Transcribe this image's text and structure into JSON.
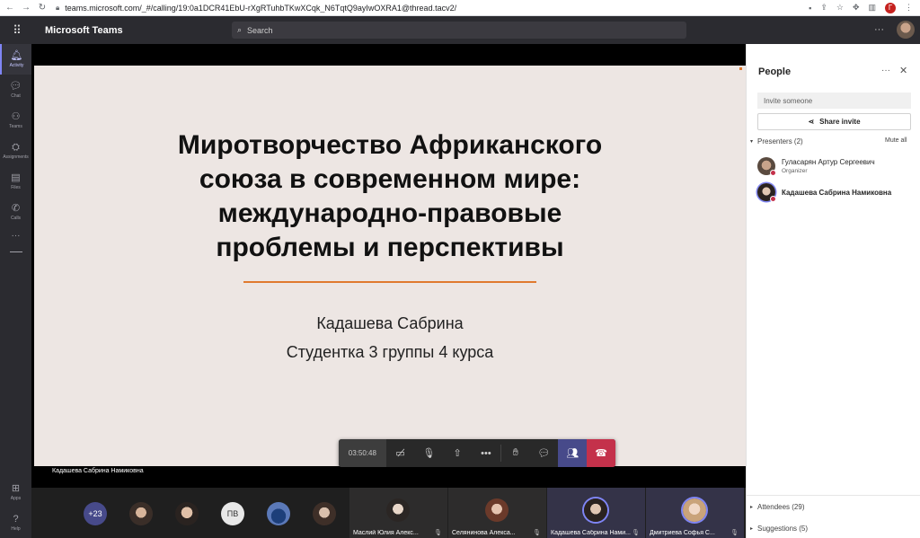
{
  "browser": {
    "url": "teams.microsoft.com/_#/calling/19:0a1DCR41EbU-rXgRTuhbTKwXCqk_N6TqtQ9ayIwOXRA1@thread.tacv2/",
    "profile_initial": "Г"
  },
  "header": {
    "app_title": "Microsoft Teams",
    "search_placeholder": "Search"
  },
  "rail": {
    "items": [
      {
        "label": "Activity",
        "icon": "bell-icon"
      },
      {
        "label": "Chat",
        "icon": "chat-icon"
      },
      {
        "label": "Teams",
        "icon": "teams-icon"
      },
      {
        "label": "Assignments",
        "icon": "assignments-icon"
      },
      {
        "label": "Files",
        "icon": "file-icon"
      },
      {
        "label": "Calls",
        "icon": "phone-icon"
      }
    ],
    "bottom": [
      {
        "label": "Apps",
        "icon": "apps-icon"
      },
      {
        "label": "Help",
        "icon": "help-icon"
      }
    ]
  },
  "slide": {
    "title_lines": [
      "Миротворчество Африканского",
      "союза в современном мире:",
      "международно-правовые",
      "проблемы и перспективы"
    ],
    "author": "Кадашева Сабрина",
    "course": "Студентка 3 группы 4 курса"
  },
  "presenter_label": "Кадашева Сабрина Намиковна",
  "controls": {
    "timer": "03:50:48"
  },
  "gallery": {
    "more_count": "+23",
    "initials": "ПВ",
    "tiles": [
      {
        "name": "Маслий Юлия Алекс..."
      },
      {
        "name": "Селянинова Алекса..."
      },
      {
        "name": "Кадашева Сабрина Нами..."
      },
      {
        "name": "Дмитриева Софья С..."
      }
    ]
  },
  "people_panel": {
    "title": "People",
    "invite_placeholder": "Invite someone",
    "share_invite": "Share invite",
    "presenters_label": "Presenters (2)",
    "mute_all": "Mute all",
    "presenters": [
      {
        "name": "Гуласарян Артур Сергеевич",
        "role": "Organizer"
      },
      {
        "name": "Кадашева Сабрина Намиковна",
        "role": ""
      }
    ],
    "attendees_label": "Attendees (29)",
    "suggestions_label": "Suggestions (5)"
  },
  "colors": {
    "accent": "#7f85f5",
    "hangup": "#c4314b",
    "slide_rule": "#e07a2f",
    "slide_bg": "#ede6e3"
  }
}
